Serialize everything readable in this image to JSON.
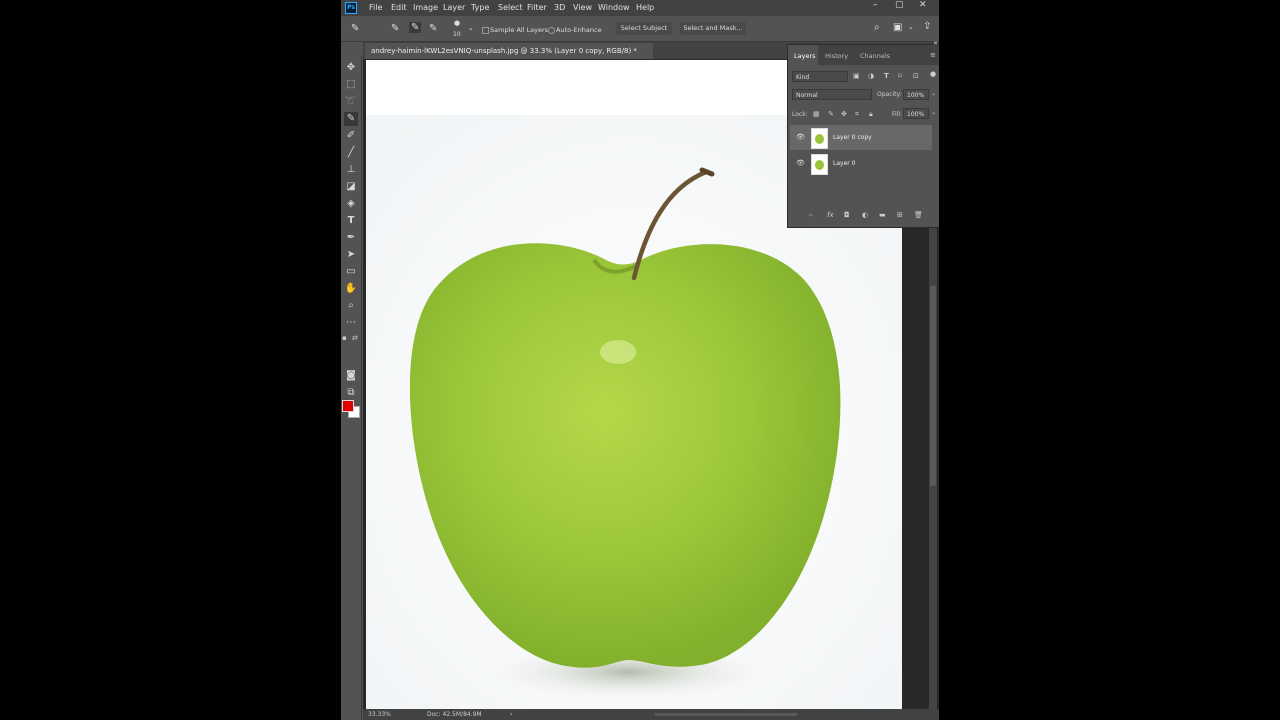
{
  "app": {
    "logo": "Ps"
  },
  "menu": [
    "File",
    "Edit",
    "Image",
    "Layer",
    "Type",
    "Select",
    "Filter",
    "3D",
    "View",
    "Window",
    "Help"
  ],
  "window_controls": {
    "minimize": "–",
    "restore": "▢",
    "close": "✕"
  },
  "options": {
    "brush_size": "10",
    "sample_all_layers": "Sample All Layers",
    "auto_enhance": "Auto-Enhance",
    "select_subject": "Select Subject",
    "select_and_mask": "Select and Mask..."
  },
  "document": {
    "tab_title": "andrey-haimin-lKWL2esVNIQ-unsplash.jpg @ 33.3% (Layer 0 copy, RGB/8) *"
  },
  "status": {
    "zoom": "33.33%",
    "doc": "Doc: 42.5M/84.9M"
  },
  "colors": {
    "foreground": "#e00000",
    "background": "#ffffff",
    "accent": "#31a8ff"
  },
  "layers_panel": {
    "tabs": [
      "Layers",
      "History",
      "Channels"
    ],
    "active_tab": "Layers",
    "filter_kind": "Kind",
    "blend_mode": "Normal",
    "opacity_label": "Opacity:",
    "opacity_value": "100%",
    "lock_label": "Lock:",
    "fill_label": "Fill:",
    "fill_value": "100%",
    "layers": [
      {
        "name": "Layer 0 copy",
        "selected": true
      },
      {
        "name": "Layer 0",
        "selected": false
      }
    ]
  }
}
